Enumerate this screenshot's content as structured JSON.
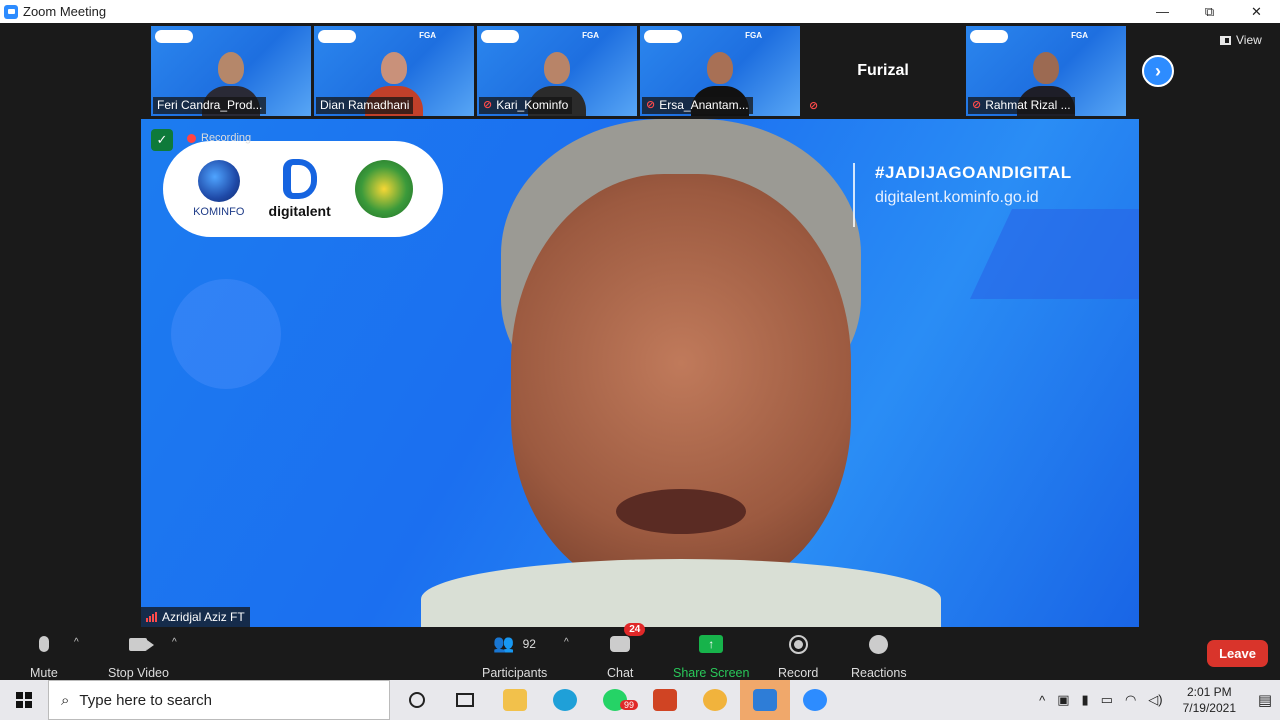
{
  "window": {
    "title": "Zoom Meeting",
    "minimize": "—",
    "maximize": "⧉",
    "close": "✕"
  },
  "participants_strip": [
    {
      "name": "Feri Candra_Prod...",
      "muted": false,
      "video": true,
      "skin": "#b5876a",
      "shirt": "#2a2a36"
    },
    {
      "name": "Dian Ramadhani",
      "muted": false,
      "video": true,
      "skin": "#c9917a",
      "shirt": "#c2402a"
    },
    {
      "name": "Kari_Kominfo",
      "muted": true,
      "video": true,
      "skin": "#b88468",
      "shirt": "#2b2b2b"
    },
    {
      "name": "Ersa_Anantam...",
      "muted": true,
      "video": true,
      "skin": "#a87055",
      "shirt": "#111111"
    },
    {
      "name": "Furizal",
      "muted": true,
      "video": false
    },
    {
      "name": "Rahmat Rizal ...",
      "muted": true,
      "video": true,
      "skin": "#9c6a52",
      "shirt": "#1e1e28"
    }
  ],
  "tile_brand": "FGA",
  "strip_next_icon": "chevron-right-icon",
  "view_label": "View",
  "main": {
    "recording_label": "Recording",
    "logos": {
      "kominfo": "KOMINFO",
      "digitalent": "digitalent"
    },
    "hashtag": "#JADIJAGOANDIGITAL",
    "url": "digitalent.kominfo.go.id",
    "speaker_name": "Azridjal Aziz FT"
  },
  "toolbar": {
    "mute": "Mute",
    "stop_video": "Stop Video",
    "participants": "Participants",
    "participants_count": "92",
    "chat": "Chat",
    "chat_badge": "24",
    "share_screen": "Share Screen",
    "record": "Record",
    "reactions": "Reactions",
    "leave": "Leave"
  },
  "taskbar": {
    "search_placeholder": "Type here to search",
    "whatsapp_badge": "99",
    "time": "2:01 PM",
    "date": "7/19/2021"
  },
  "colors": {
    "zoom_blue": "#2d8cff",
    "leave_red": "#d9342b",
    "share_green": "#29c759",
    "bg_dark": "#1a1a1a"
  }
}
